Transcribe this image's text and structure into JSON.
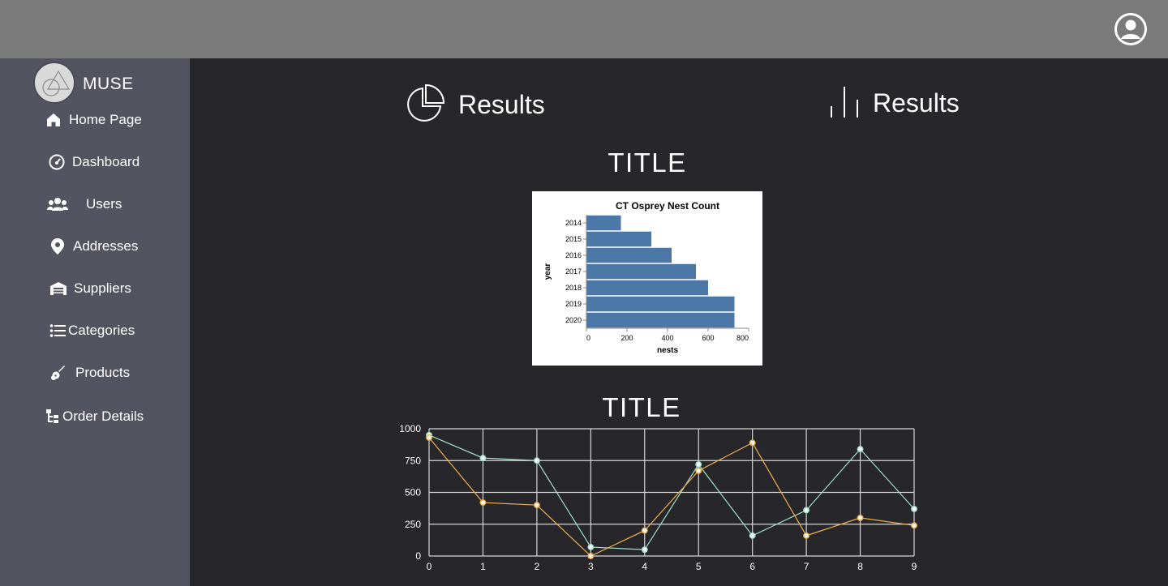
{
  "app": {
    "brand": "MUSE"
  },
  "header": {
    "profile_icon": "user-circle-icon"
  },
  "sidebar": {
    "items": [
      {
        "label": "Home Page",
        "icon": "home-icon"
      },
      {
        "label": "Dashboard",
        "icon": "speedometer-icon"
      },
      {
        "label": "Users",
        "icon": "users-icon"
      },
      {
        "label": "Addresses",
        "icon": "map-pin-icon"
      },
      {
        "label": "Suppliers",
        "icon": "warehouse-icon"
      },
      {
        "label": "Categories",
        "icon": "list-icon"
      },
      {
        "label": "Products",
        "icon": "guitar-icon"
      },
      {
        "label": "Order Details",
        "icon": "tree-icon"
      }
    ]
  },
  "main": {
    "results_left": {
      "label": "Results",
      "icon": "pie-chart-icon"
    },
    "results_right": {
      "label": "Results",
      "icon": "bar-chart-icon"
    },
    "bar_section_title": "TITLE",
    "line_section_title": "TITLE"
  },
  "colors": {
    "background": "#27272b",
    "sidebar": "#545460",
    "topbar": "#7a7a7a",
    "bar": "#4c78a8",
    "series_green": "#9fe0c8",
    "series_orange": "#f0b04a"
  },
  "chart_data": [
    {
      "type": "bar",
      "orientation": "horizontal",
      "title": "CT Osprey Nest Count",
      "xlabel": "nests",
      "ylabel": "year",
      "categories": [
        "2014",
        "2015",
        "2016",
        "2017",
        "2018",
        "2019",
        "2020"
      ],
      "values": [
        170,
        320,
        420,
        540,
        600,
        730,
        730
      ],
      "xlim": [
        0,
        800
      ],
      "xticks": [
        0,
        200,
        400,
        600,
        800
      ]
    },
    {
      "type": "line",
      "x": [
        0,
        1,
        2,
        3,
        4,
        5,
        6,
        7,
        8,
        9
      ],
      "ylim": [
        0,
        1000
      ],
      "yticks": [
        0,
        250,
        500,
        750,
        1000
      ],
      "grid": true,
      "series": [
        {
          "color": "#9fe0c8",
          "values": [
            950,
            770,
            750,
            70,
            50,
            720,
            160,
            360,
            840,
            370
          ]
        },
        {
          "color": "#f0b04a",
          "values": [
            930,
            420,
            400,
            0,
            200,
            670,
            890,
            160,
            300,
            240
          ]
        }
      ]
    }
  ]
}
